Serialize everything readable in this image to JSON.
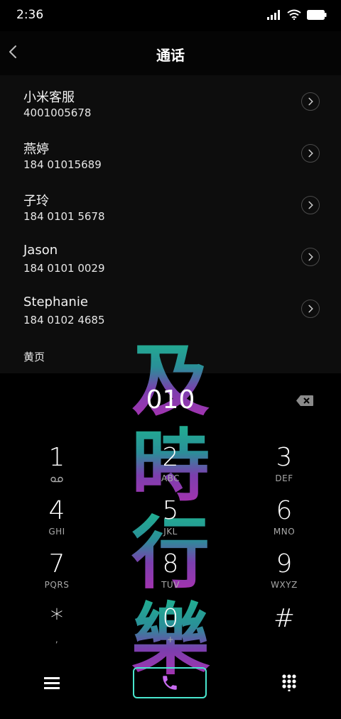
{
  "status": {
    "time": "2:36"
  },
  "header": {
    "title": "通话"
  },
  "contacts": [
    {
      "name": "小米客服",
      "number": "4001005678"
    },
    {
      "name": "燕婷",
      "number": "184 01015689"
    },
    {
      "name": "子玲",
      "number": "184 0101 5678"
    },
    {
      "name": "Jason",
      "number": "184 0101 0029"
    },
    {
      "name": "Stephanie",
      "number": "184 0102 4685"
    }
  ],
  "section": {
    "label": "黄页"
  },
  "dialer": {
    "input": "010",
    "keys": [
      {
        "digit": "1",
        "letters": ""
      },
      {
        "digit": "2",
        "letters": "ABC"
      },
      {
        "digit": "3",
        "letters": "DEF"
      },
      {
        "digit": "4",
        "letters": "GHI"
      },
      {
        "digit": "5",
        "letters": "JKL"
      },
      {
        "digit": "6",
        "letters": "MNO"
      },
      {
        "digit": "7",
        "letters": "PQRS"
      },
      {
        "digit": "8",
        "letters": "TUV"
      },
      {
        "digit": "9",
        "letters": "WXYZ"
      },
      {
        "digit": "*",
        "letters": ","
      },
      {
        "digit": "0",
        "letters": "+"
      },
      {
        "digit": "#",
        "letters": ""
      }
    ]
  },
  "watermark": {
    "text": [
      "及",
      "時",
      "行",
      "樂"
    ]
  },
  "colors": {
    "accent": "#49e6ce",
    "call_button_border": "#49e6ce",
    "phone_icon": "#c86bf0"
  },
  "icons": {
    "back": "back-chevron-icon",
    "backspace": "backspace-icon",
    "menu": "menu-icon",
    "call": "phone-icon",
    "keypad": "keypad-icon",
    "voicemail": "voicemail-icon"
  }
}
